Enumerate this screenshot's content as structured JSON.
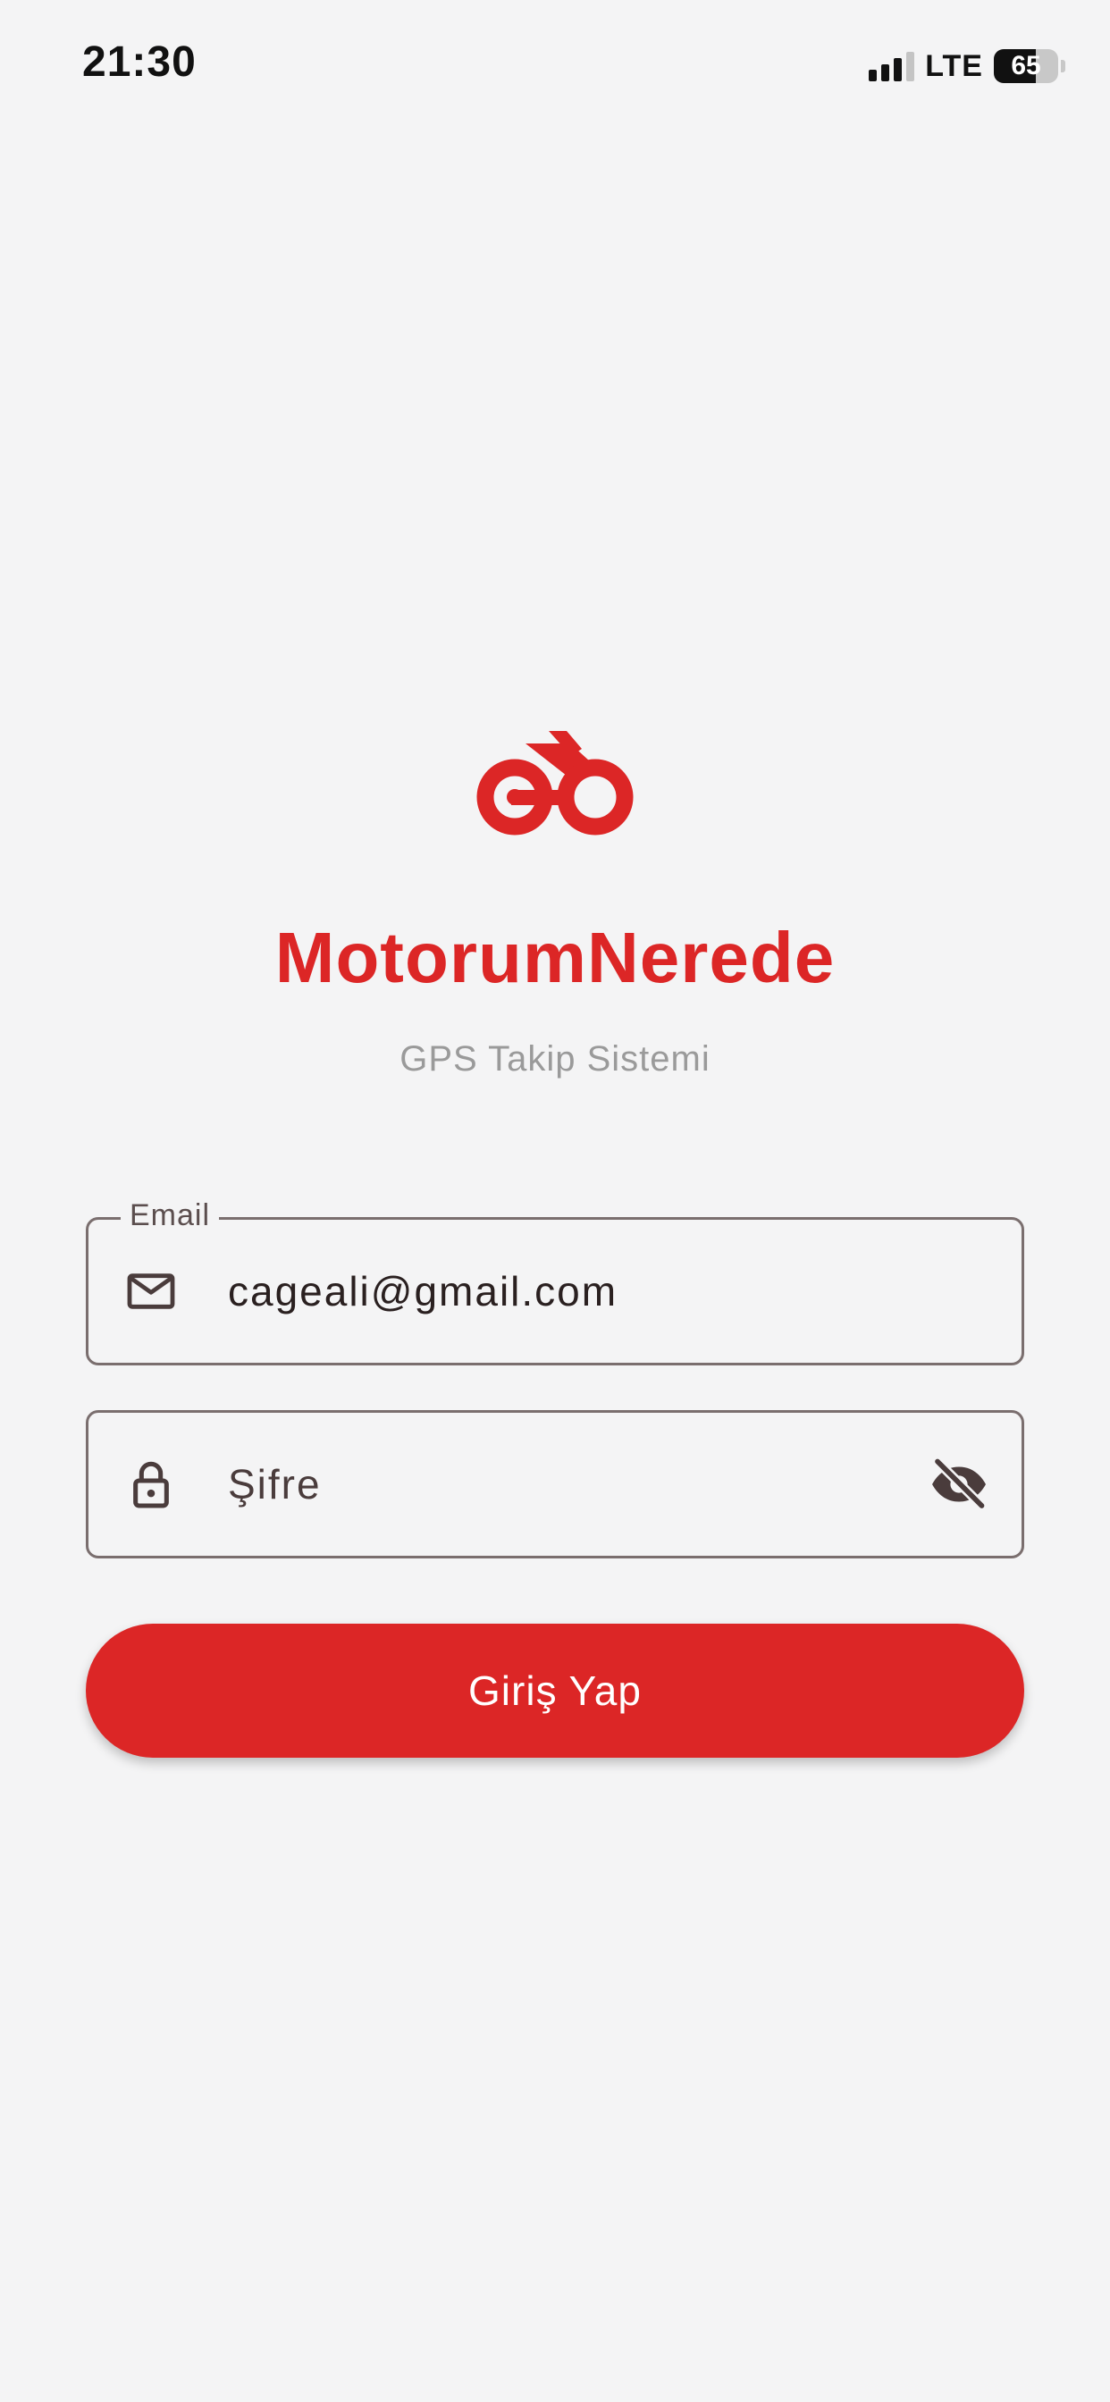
{
  "status_bar": {
    "time": "21:30",
    "network": "LTE",
    "battery": "65",
    "battery_level": 0.65
  },
  "brand": {
    "logo_icon": "motorcycle-icon",
    "title": "MotorumNerede",
    "subtitle": "GPS Takip Sistemi",
    "accent_color": "#dc2626"
  },
  "form": {
    "email": {
      "label": "Email",
      "value": "cageali@gmail.com",
      "icon": "mail-icon"
    },
    "password": {
      "placeholder": "Şifre",
      "icon": "lock-icon",
      "toggle_icon": "eye-off-icon"
    },
    "submit_label": "Giriş Yap"
  }
}
